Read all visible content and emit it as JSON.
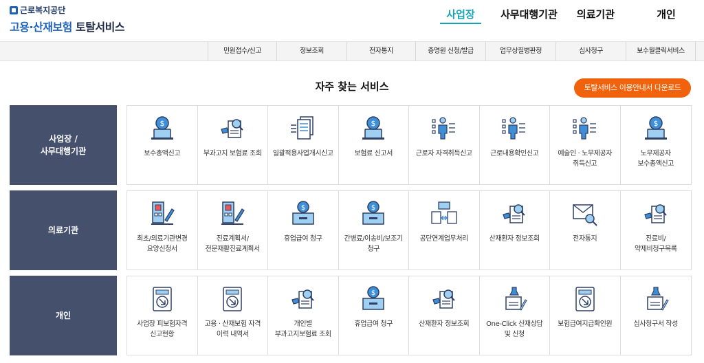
{
  "header": {
    "org": "근로복지공단",
    "title_blue": "고용·산재보험",
    "title_dark": " 토탈서비스",
    "nav": [
      "사업장",
      "사무대행기관",
      "의료기관",
      "개인"
    ]
  },
  "submenu": [
    "민원접수/신고",
    "정보조회",
    "전자통지",
    "증명원 신청/발급",
    "업무상질병판정",
    "심사청구",
    "보수월클릭서비스"
  ],
  "section_title": "자주 찾는 서비스",
  "guide_button": "토탈서비스 이용안내서 다운로드",
  "rows": [
    {
      "label": "사업장 /\n사무대행기관",
      "items": [
        {
          "label": "보수총액신고",
          "icon": "coin-laptop-icon"
        },
        {
          "label": "부과고지 보험료 조회",
          "icon": "document-search-icon"
        },
        {
          "label": "일괄적용사업개시신고",
          "icon": "documents-arrow-icon"
        },
        {
          "label": "보험료 신고서",
          "icon": "coin-laptop-icon"
        },
        {
          "label": "근로자 자격취득신고",
          "icon": "person-checklist-icon"
        },
        {
          "label": "근로내용확인신고",
          "icon": "person-checklist-icon"
        },
        {
          "label": "예술인 · 노무제공자 취득신고",
          "icon": "person-checklist-icon"
        },
        {
          "label": "노무제공자 보수총액신고",
          "icon": "coin-laptop-icon"
        }
      ]
    },
    {
      "label": "의료기관",
      "items": [
        {
          "label": "최초/의료기관변경 요양신청서",
          "icon": "hospital-pen-icon"
        },
        {
          "label": "진료계획서/전문재활진료계획서",
          "icon": "hospital-pen-icon"
        },
        {
          "label": "휴업급여 청구",
          "icon": "coin-box-icon"
        },
        {
          "label": "간병료/이송비/보조기 청구",
          "icon": "coin-box-icon"
        },
        {
          "label": "공단연계업무처리",
          "icon": "file-exchange-icon"
        },
        {
          "label": "산재환자 정보조회",
          "icon": "document-search-icon"
        },
        {
          "label": "전자통지",
          "icon": "envelope-search-icon"
        },
        {
          "label": "진료비/약제비청구목록",
          "icon": "document-search-icon"
        }
      ]
    },
    {
      "label": "개인",
      "items": [
        {
          "label": "사업장 피보험자격 신고현황",
          "icon": "download-tray-icon"
        },
        {
          "label": "고용 · 산재보험 자격 이력 내역서",
          "icon": "download-tray-icon"
        },
        {
          "label": "개인별 부과고지보험료 조회",
          "icon": "document-search-icon"
        },
        {
          "label": "휴업급여 청구",
          "icon": "coin-box-icon"
        },
        {
          "label": "산재환자 정보조회",
          "icon": "document-search-icon"
        },
        {
          "label": "One-Click 산재상담 및 신청",
          "icon": "stamp-pen-icon"
        },
        {
          "label": "보험급여지급확인원",
          "icon": "download-tray-icon"
        },
        {
          "label": "심사청구서 작성",
          "icon": "stamp-pen-icon"
        }
      ]
    }
  ]
}
